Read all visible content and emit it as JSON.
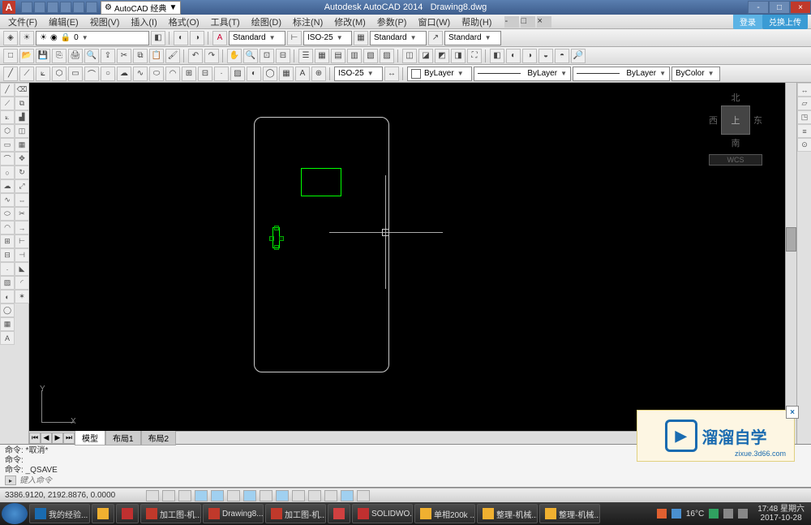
{
  "title": {
    "app": "Autodesk AutoCAD 2014",
    "file": "Drawing8.dwg",
    "workspace": "AutoCAD 经典"
  },
  "menu": [
    "文件(F)",
    "编辑(E)",
    "视图(V)",
    "插入(I)",
    "格式(O)",
    "工具(T)",
    "绘图(D)",
    "标注(N)",
    "修改(M)",
    "参数(P)",
    "窗口(W)",
    "帮助(H)"
  ],
  "cloud": {
    "login": "登录",
    "upload": "兑换上传"
  },
  "styles": {
    "layer": "0",
    "text": "Standard",
    "dim": "ISO-25",
    "table": "Standard",
    "mleader": "Standard"
  },
  "layer_props": {
    "layer": "ByLayer",
    "lw": "ByLayer",
    "lt": "ByLayer",
    "color": "ByColor"
  },
  "viewcube": {
    "n": "北",
    "s": "南",
    "e": "东",
    "w": "西",
    "top": "上",
    "wcs": "WCS"
  },
  "ucs": {
    "x": "X",
    "y": "Y"
  },
  "tabs": [
    "模型",
    "布局1",
    "布局2"
  ],
  "cmd": {
    "l1": "命令: *取消*",
    "l2": "命令:",
    "l3": "命令:  _QSAVE",
    "prompt": "键入命令"
  },
  "status": {
    "coords": "3386.9120, 2192.8876, 0.0000"
  },
  "watermark": {
    "brand": "溜溜自学",
    "url": "zixue.3d66.com",
    "close": "×"
  },
  "taskbar": {
    "items": [
      "我的经验...",
      "",
      "",
      "加工图-机...",
      "Drawing8...",
      "加工图-机...",
      "",
      "SOLIDWO...",
      "单相200k ...",
      "整理-机械...",
      "整理-机械..."
    ],
    "temp": "16°C",
    "time": "17:48 星期六",
    "date": "2017-10-28"
  }
}
